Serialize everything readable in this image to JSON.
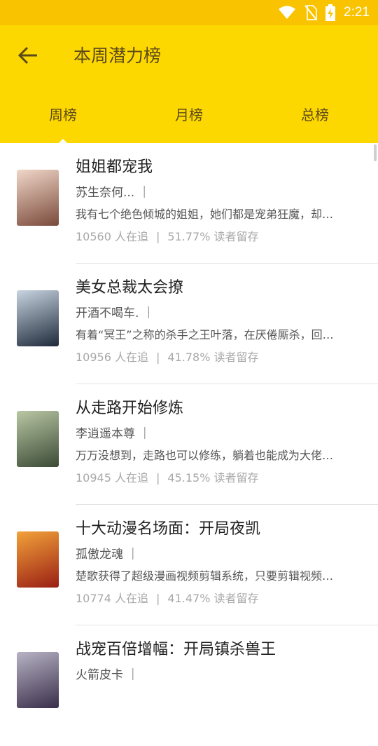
{
  "status": {
    "time": "2:21"
  },
  "header": {
    "title": "本周潜力榜"
  },
  "tabs": [
    {
      "label": "周榜"
    },
    {
      "label": "月榜"
    },
    {
      "label": "总榜"
    }
  ],
  "stat_separator": "|",
  "books": [
    {
      "name": "姐姐都宠我",
      "author": "苏生奈何... ｜",
      "desc": "我有七个绝色倾城的姐姐，她们都是宠弟狂魔，却…",
      "followers": "10560 人在追",
      "retention": "51.77% 读者留存",
      "cover_colors": [
        "#f0d7c9",
        "#7a4a3a"
      ]
    },
    {
      "name": "美女总裁太会撩",
      "author": "开酒不喝车. ｜",
      "desc": "有着“冥王”之称的杀手之王叶落，在厌倦厮杀，回…",
      "followers": "10956 人在追",
      "retention": "41.78% 读者留存",
      "cover_colors": [
        "#c8d4e0",
        "#1e2a3a"
      ]
    },
    {
      "name": "从走路开始修炼",
      "author": "李逍遥本尊 ｜",
      "desc": "万万没想到，走路也可以修练，躺着也能成为大佬…",
      "followers": "10945 人在追",
      "retention": "45.15% 读者留存",
      "cover_colors": [
        "#b9c7a4",
        "#3b4a35"
      ]
    },
    {
      "name": "十大动漫名场面：开局夜凯",
      "author": "孤傲龙魂 ｜",
      "desc": "楚歌获得了超级漫画视频剪辑系统，只要剪辑视频…",
      "followers": "10774 人在追",
      "retention": "41.47% 读者留存",
      "cover_colors": [
        "#f2a23a",
        "#9a1f14"
      ]
    },
    {
      "name": "战宠百倍增幅：开局镇杀兽王",
      "author": "火箭皮卡 ｜",
      "desc": "",
      "followers": "",
      "retention": "",
      "cover_colors": [
        "#b7b3c4",
        "#3a2e4a"
      ]
    }
  ]
}
